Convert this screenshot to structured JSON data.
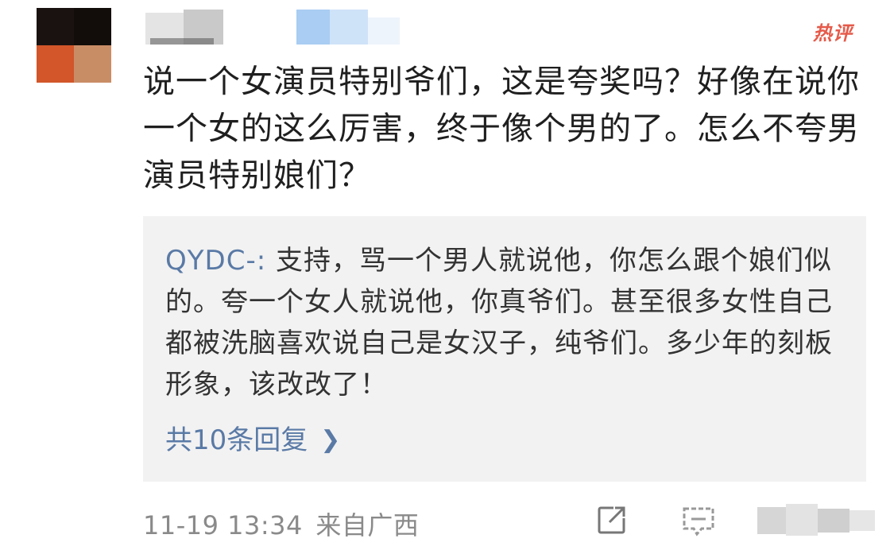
{
  "comment": {
    "badge": "热评",
    "text": "说一个女演员特别爷们，这是夸奖吗？好像在说你一个女的这么厉害，终于像个男的了。怎么不夸男演员特别娘们？",
    "timestamp": "11-19 13:34",
    "location": "来自广西"
  },
  "reply": {
    "author": "QYDC-:",
    "text": " 支持，骂一个男人就说他，你怎么跟个娘们似的。夸一个女人就说他，你真爷们。甚至很多女性自己都被洗脑喜欢说自己是女汉子，纯爷们。多少年的刻板形象，该改改了！",
    "more_replies": "共10条回复"
  },
  "icons": {
    "share": "share-icon",
    "comment": "comment-icon",
    "more": "chevron-right-icon"
  },
  "colors": {
    "badge": "#e65a4a",
    "link": "#5a7aa6",
    "reply_bg": "#f2f2f2"
  }
}
